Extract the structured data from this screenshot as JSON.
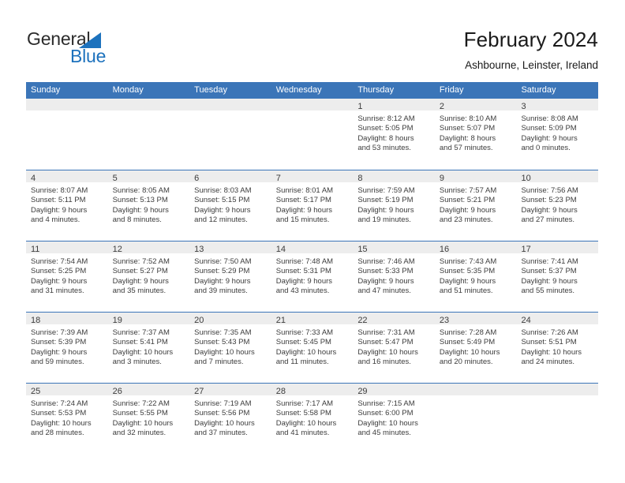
{
  "brand": {
    "name_part1": "General",
    "name_part2": "Blue",
    "logo_icon": "blue-triangle-logo"
  },
  "header": {
    "title": "February 2024",
    "subtitle": "Ashbourne, Leinster, Ireland"
  },
  "colors": {
    "header_blue": "#3b75b8",
    "brand_blue": "#1d72bd",
    "daynum_band": "#ededed",
    "text": "#3c3c3c"
  },
  "weekdays": [
    "Sunday",
    "Monday",
    "Tuesday",
    "Wednesday",
    "Thursday",
    "Friday",
    "Saturday"
  ],
  "weeks": [
    [
      {
        "day": "",
        "info": ""
      },
      {
        "day": "",
        "info": ""
      },
      {
        "day": "",
        "info": ""
      },
      {
        "day": "",
        "info": ""
      },
      {
        "day": "1",
        "info": "Sunrise: 8:12 AM\nSunset: 5:05 PM\nDaylight: 8 hours\nand 53 minutes."
      },
      {
        "day": "2",
        "info": "Sunrise: 8:10 AM\nSunset: 5:07 PM\nDaylight: 8 hours\nand 57 minutes."
      },
      {
        "day": "3",
        "info": "Sunrise: 8:08 AM\nSunset: 5:09 PM\nDaylight: 9 hours\nand 0 minutes."
      }
    ],
    [
      {
        "day": "4",
        "info": "Sunrise: 8:07 AM\nSunset: 5:11 PM\nDaylight: 9 hours\nand 4 minutes."
      },
      {
        "day": "5",
        "info": "Sunrise: 8:05 AM\nSunset: 5:13 PM\nDaylight: 9 hours\nand 8 minutes."
      },
      {
        "day": "6",
        "info": "Sunrise: 8:03 AM\nSunset: 5:15 PM\nDaylight: 9 hours\nand 12 minutes."
      },
      {
        "day": "7",
        "info": "Sunrise: 8:01 AM\nSunset: 5:17 PM\nDaylight: 9 hours\nand 15 minutes."
      },
      {
        "day": "8",
        "info": "Sunrise: 7:59 AM\nSunset: 5:19 PM\nDaylight: 9 hours\nand 19 minutes."
      },
      {
        "day": "9",
        "info": "Sunrise: 7:57 AM\nSunset: 5:21 PM\nDaylight: 9 hours\nand 23 minutes."
      },
      {
        "day": "10",
        "info": "Sunrise: 7:56 AM\nSunset: 5:23 PM\nDaylight: 9 hours\nand 27 minutes."
      }
    ],
    [
      {
        "day": "11",
        "info": "Sunrise: 7:54 AM\nSunset: 5:25 PM\nDaylight: 9 hours\nand 31 minutes."
      },
      {
        "day": "12",
        "info": "Sunrise: 7:52 AM\nSunset: 5:27 PM\nDaylight: 9 hours\nand 35 minutes."
      },
      {
        "day": "13",
        "info": "Sunrise: 7:50 AM\nSunset: 5:29 PM\nDaylight: 9 hours\nand 39 minutes."
      },
      {
        "day": "14",
        "info": "Sunrise: 7:48 AM\nSunset: 5:31 PM\nDaylight: 9 hours\nand 43 minutes."
      },
      {
        "day": "15",
        "info": "Sunrise: 7:46 AM\nSunset: 5:33 PM\nDaylight: 9 hours\nand 47 minutes."
      },
      {
        "day": "16",
        "info": "Sunrise: 7:43 AM\nSunset: 5:35 PM\nDaylight: 9 hours\nand 51 minutes."
      },
      {
        "day": "17",
        "info": "Sunrise: 7:41 AM\nSunset: 5:37 PM\nDaylight: 9 hours\nand 55 minutes."
      }
    ],
    [
      {
        "day": "18",
        "info": "Sunrise: 7:39 AM\nSunset: 5:39 PM\nDaylight: 9 hours\nand 59 minutes."
      },
      {
        "day": "19",
        "info": "Sunrise: 7:37 AM\nSunset: 5:41 PM\nDaylight: 10 hours\nand 3 minutes."
      },
      {
        "day": "20",
        "info": "Sunrise: 7:35 AM\nSunset: 5:43 PM\nDaylight: 10 hours\nand 7 minutes."
      },
      {
        "day": "21",
        "info": "Sunrise: 7:33 AM\nSunset: 5:45 PM\nDaylight: 10 hours\nand 11 minutes."
      },
      {
        "day": "22",
        "info": "Sunrise: 7:31 AM\nSunset: 5:47 PM\nDaylight: 10 hours\nand 16 minutes."
      },
      {
        "day": "23",
        "info": "Sunrise: 7:28 AM\nSunset: 5:49 PM\nDaylight: 10 hours\nand 20 minutes."
      },
      {
        "day": "24",
        "info": "Sunrise: 7:26 AM\nSunset: 5:51 PM\nDaylight: 10 hours\nand 24 minutes."
      }
    ],
    [
      {
        "day": "25",
        "info": "Sunrise: 7:24 AM\nSunset: 5:53 PM\nDaylight: 10 hours\nand 28 minutes."
      },
      {
        "day": "26",
        "info": "Sunrise: 7:22 AM\nSunset: 5:55 PM\nDaylight: 10 hours\nand 32 minutes."
      },
      {
        "day": "27",
        "info": "Sunrise: 7:19 AM\nSunset: 5:56 PM\nDaylight: 10 hours\nand 37 minutes."
      },
      {
        "day": "28",
        "info": "Sunrise: 7:17 AM\nSunset: 5:58 PM\nDaylight: 10 hours\nand 41 minutes."
      },
      {
        "day": "29",
        "info": "Sunrise: 7:15 AM\nSunset: 6:00 PM\nDaylight: 10 hours\nand 45 minutes."
      },
      {
        "day": "",
        "info": ""
      },
      {
        "day": "",
        "info": ""
      }
    ]
  ]
}
